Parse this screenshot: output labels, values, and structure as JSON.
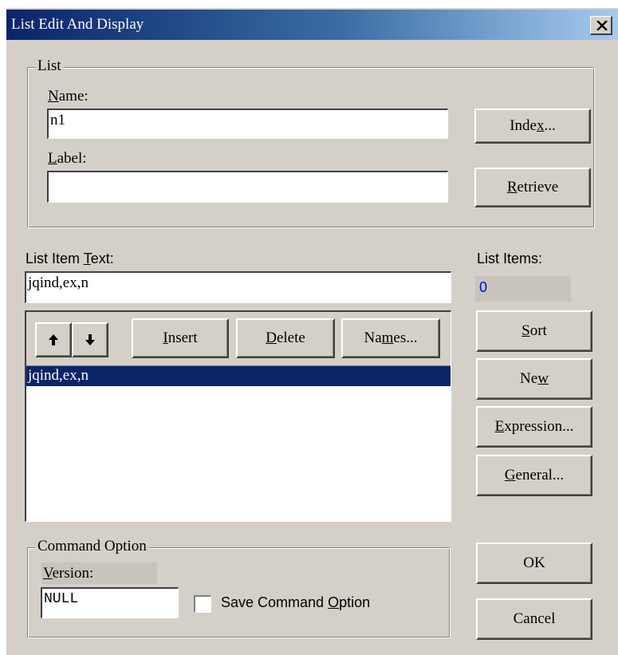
{
  "window": {
    "title": "List Edit And Display",
    "close_icon": "close-icon"
  },
  "list_group": {
    "legend": "List",
    "name_label": "Name:",
    "name_value": "n1",
    "label_label": "Label:",
    "label_value": "",
    "index_button": "Index...",
    "retrieve_button": "Retrieve"
  },
  "list_item": {
    "text_label": "List Item Text:",
    "text_value": "jqind,ex,n",
    "items_label": "List Items:",
    "items_count": "0"
  },
  "toolbar": {
    "up_icon": "arrow-up-icon",
    "down_icon": "arrow-down-icon",
    "insert_button": "Insert",
    "delete_button": "Delete",
    "names_button": "Names..."
  },
  "list": {
    "items": [
      "jqind,ex,n"
    ]
  },
  "side_buttons": {
    "sort": "Sort",
    "new": "New",
    "expression": "Expression...",
    "general": "General...",
    "ok": "OK",
    "cancel": "Cancel"
  },
  "command_option": {
    "legend": "Command Option",
    "version_label": "Version:",
    "version_value": "NULL",
    "save_checkbox_label": "Save Command Option",
    "save_checked": false
  },
  "colors": {
    "title_start": "#0a246a",
    "title_end": "#a6caf0",
    "dialog_bg": "#d4d0c8",
    "selection": "#0a246a",
    "count_text": "#0000ff"
  }
}
